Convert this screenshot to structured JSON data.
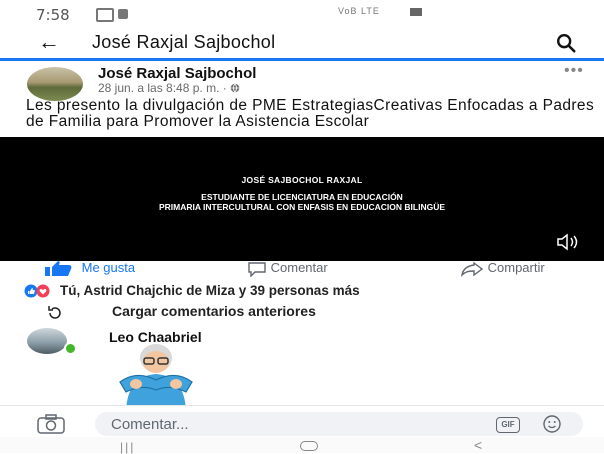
{
  "status_bar": {
    "time": "7:58",
    "system_indicators": "VoB LTE"
  },
  "header": {
    "back_icon": "arrow-left-icon",
    "title": "José Raxjal Sajbochol",
    "search_icon": "search-icon"
  },
  "post": {
    "author": "José Raxjal Sajbochol",
    "timestamp": "28 jun. a las 8:48 p. m. · ",
    "privacy_icon": "globe-icon",
    "more_icon": "more-dots-icon",
    "text": "Les presento la divulgación de PME EstrategiasCreativas Enfocadas a Padres de Familia para Promover la Asistencia Escolar",
    "video": {
      "line1": "JOSÉ SAJBOCHOL RAXJAL",
      "line2": "ESTUDIANTE DE LICENCIATURA EN EDUCACIÓN",
      "line3": "PRIMARIA INTERCULTURAL CON ENFASIS EN EDUCACION BILINGÜE",
      "sound_icon": "speaker-icon"
    }
  },
  "actions": {
    "like": "Me gusta",
    "comment": "Comentar",
    "share": "Compartir"
  },
  "reactions": {
    "text": "Tú, Astrid Chajchic de Miza y 39 personas más"
  },
  "comments": {
    "load_previous": "Cargar comentarios anteriores",
    "first_commenter": "Leo Chaabriel"
  },
  "composer": {
    "placeholder": "Comentar...",
    "gif_label": "GIF",
    "camera_icon": "camera-icon",
    "emoji_icon": "smiley-icon"
  },
  "colors": {
    "accent": "#1877f2",
    "like_red": "#f33e58",
    "online": "#42b72a"
  }
}
